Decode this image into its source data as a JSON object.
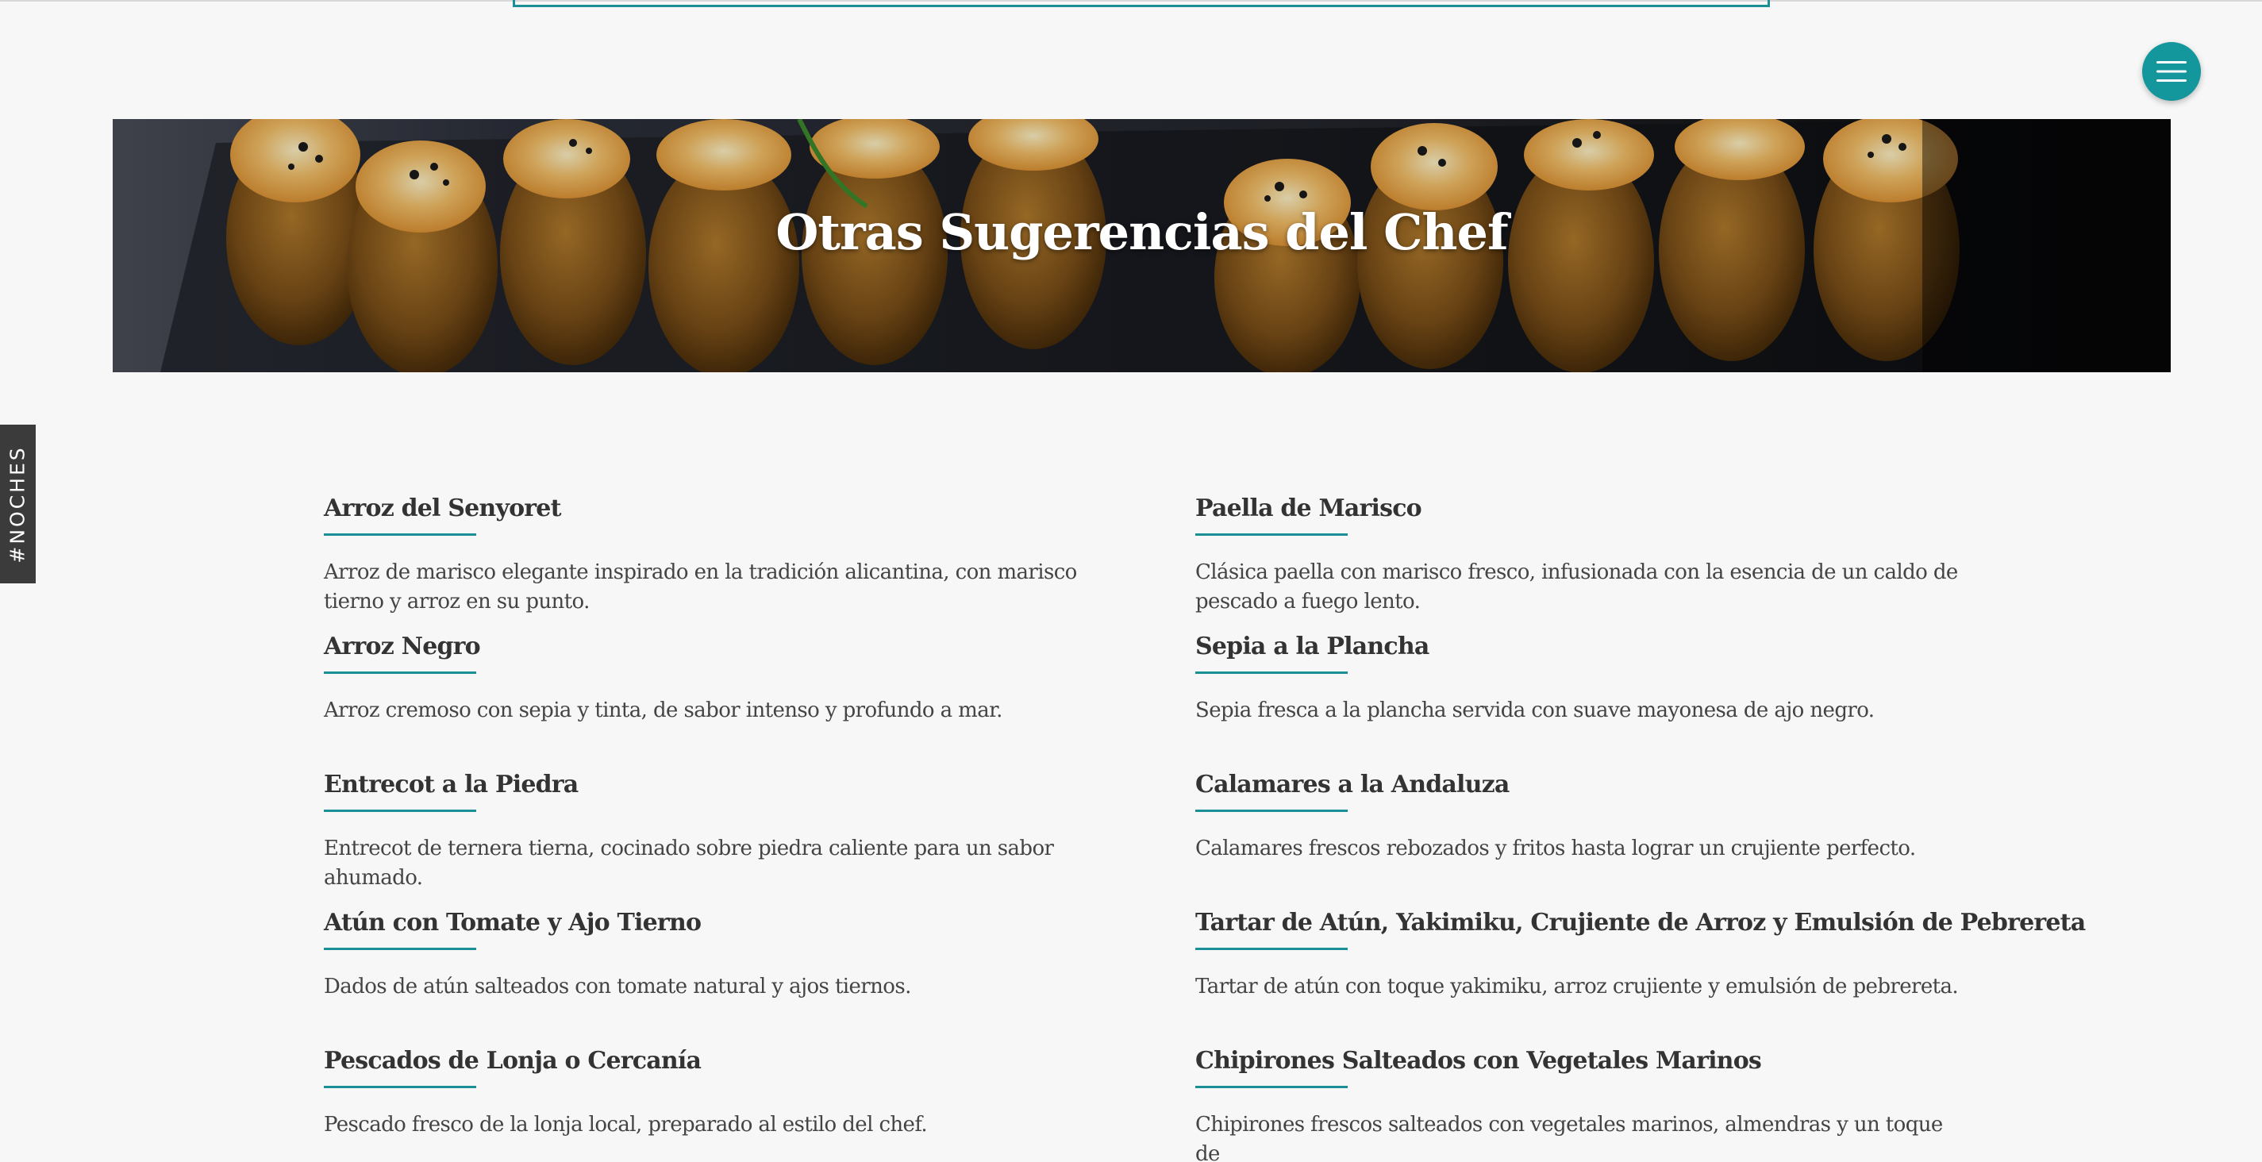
{
  "header": {
    "menu_icon": "hamburger-menu-icon"
  },
  "hero": {
    "title": "Otras Sugerencias del Chef"
  },
  "side_tab": {
    "label": "#NOCHES"
  },
  "menu": {
    "left": [
      {
        "title": "Arroz del Senyoret",
        "description": "Arroz de marisco elegante inspirado en la tradición alicantina, con marisco tierno y arroz en su punto."
      },
      {
        "title": "Arroz Negro",
        "description": "Arroz cremoso con sepia y tinta, de sabor intenso y profundo a mar."
      },
      {
        "title": "Entrecot a la Piedra",
        "description": "Entrecot de ternera tierna, cocinado sobre piedra caliente para un sabor ahumado."
      },
      {
        "title": "Atún con Tomate y Ajo Tierno",
        "description": "Dados de atún salteados con tomate natural y ajos tiernos."
      },
      {
        "title": "Pescados de Lonja o Cercanía",
        "description": "Pescado fresco de la lonja local, preparado al estilo del chef."
      }
    ],
    "right": [
      {
        "title": "Paella de Marisco",
        "description": "Clásica paella con marisco fresco, infusionada con la esencia de un caldo de pescado a fuego lento."
      },
      {
        "title": "Sepia a la Plancha",
        "description": "Sepia fresca a la plancha servida con suave mayonesa de ajo negro."
      },
      {
        "title": "Calamares a la Andaluza",
        "description": "Calamares frescos rebozados y fritos hasta lograr un crujiente perfecto."
      },
      {
        "title": "Tartar de Atún, Yakimiku, Crujiente de Arroz y Emulsión de Pebrereta",
        "description": "Tartar de atún con toque yakimiku, arroz crujiente y emulsión de pebrereta."
      },
      {
        "title": "Chipirones Salteados con Vegetales Marinos",
        "description": "Chipirones frescos salteados con vegetales marinos, almendras y un toque de"
      }
    ]
  },
  "colors": {
    "accent": "#13969c",
    "background": "#f7f7f7",
    "side_tab": "#3b3b3b"
  }
}
